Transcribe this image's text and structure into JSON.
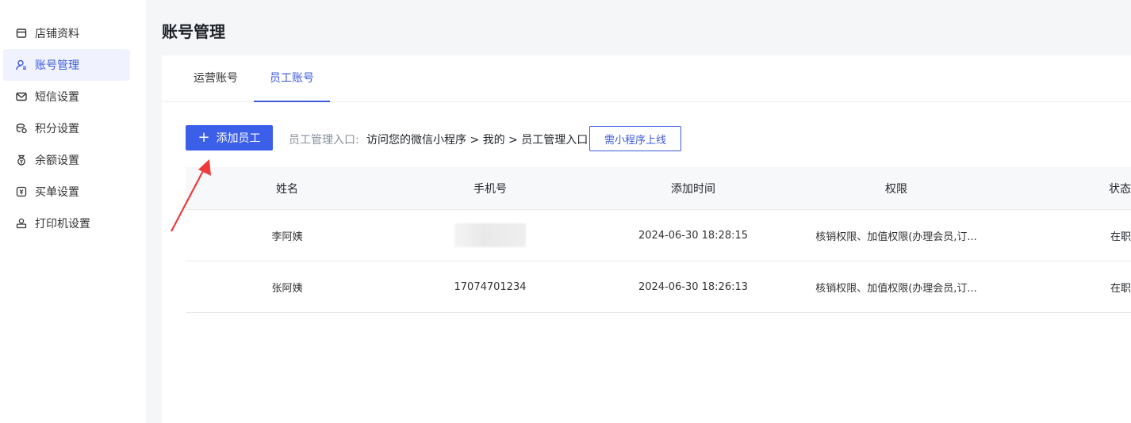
{
  "sidebar": {
    "items": [
      {
        "label": "店铺资料",
        "icon": "store-icon",
        "active": false
      },
      {
        "label": "账号管理",
        "icon": "user-account-icon",
        "active": true
      },
      {
        "label": "短信设置",
        "icon": "mail-icon",
        "active": false
      },
      {
        "label": "积分设置",
        "icon": "points-icon",
        "active": false
      },
      {
        "label": "余额设置",
        "icon": "balance-icon",
        "active": false
      },
      {
        "label": "买单设置",
        "icon": "payment-icon",
        "active": false
      },
      {
        "label": "打印机设置",
        "icon": "printer-icon",
        "active": false
      }
    ]
  },
  "page": {
    "title": "账号管理"
  },
  "tabs": [
    {
      "label": "运营账号",
      "active": false
    },
    {
      "label": "员工账号",
      "active": true
    }
  ],
  "toolbar": {
    "add_label": "添加员工",
    "entry_label": "员工管理入口:",
    "entry_path": "访问您的微信小程序 > 我的 > 员工管理入口",
    "online_label": "需小程序上线"
  },
  "table": {
    "headers": [
      "姓名",
      "手机号",
      "添加时间",
      "权限",
      "状态"
    ],
    "rows": [
      {
        "name": "李阿姨",
        "phone": "",
        "time": "2024-06-30 18:28:15",
        "perm": "核销权限、加值权限(办理会员,订...",
        "status": "在职"
      },
      {
        "name": "张阿姨",
        "phone": "17074701234",
        "time": "2024-06-30 18:26:13",
        "perm": "核销权限、加值权限(办理会员,订...",
        "status": "在职"
      }
    ]
  },
  "colors": {
    "accent": "#3d5bdb",
    "button": "#3b5fe8",
    "arrow": "#f03a3a"
  }
}
